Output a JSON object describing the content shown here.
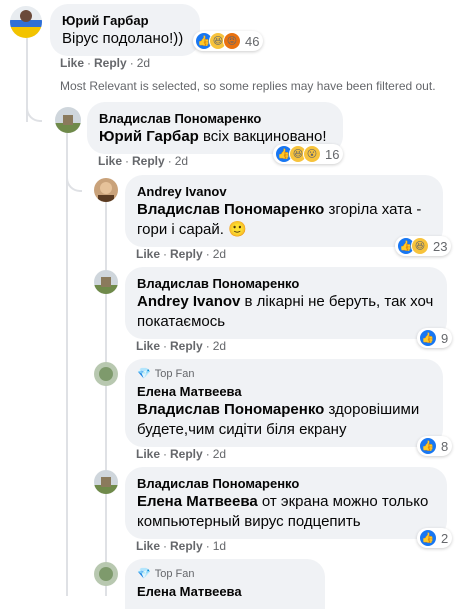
{
  "comments": [
    {
      "author": "Юрий Гарбар",
      "text": "Вірус подолано!))",
      "reactions_count": "46",
      "like": "Like",
      "reply": "Reply",
      "time": "2d"
    },
    {
      "author": "Владислав Пономаренко",
      "mention": "Юрий Гарбар",
      "text": " всіх вакциновано!",
      "reactions_count": "16",
      "like": "Like",
      "reply": "Reply",
      "time": "2d"
    },
    {
      "author": "Andrey Ivanov",
      "mention": "Владислав Пономаренко",
      "text": " згоріла хата - гори і сарай. 🙂",
      "reactions_count": "23",
      "like": "Like",
      "reply": "Reply",
      "time": "2d"
    },
    {
      "author": "Владислав Пономаренко",
      "mention": "Andrey Ivanov",
      "text": " в лікарні не беруть, так хоч покатаємось",
      "reactions_count": "9",
      "like": "Like",
      "reply": "Reply",
      "time": "2d"
    },
    {
      "badge": "Top Fan",
      "author": "Елена Матвеева",
      "mention": "Владислав Пономаренко",
      "text": " здоровішими будете,чим сидіти біля екрану",
      "reactions_count": "8",
      "like": "Like",
      "reply": "Reply",
      "time": "2d"
    },
    {
      "author": "Владислав Пономаренко",
      "mention": "Елена Матвеева",
      "text": " от экрана можно только компьютерный вирус подцепить",
      "reactions_count": "2",
      "like": "Like",
      "reply": "Reply",
      "time": "1d"
    },
    {
      "badge": "Top Fan",
      "author": "Елена Матвеева"
    }
  ],
  "filter_note": "Most Relevant is selected, so some replies may have been filtered out.",
  "colors": {
    "bubble": "#f0f2f5",
    "meta_text": "#65676b",
    "like_blue": "#1877f2",
    "thread_line": "#dfe1e5"
  }
}
